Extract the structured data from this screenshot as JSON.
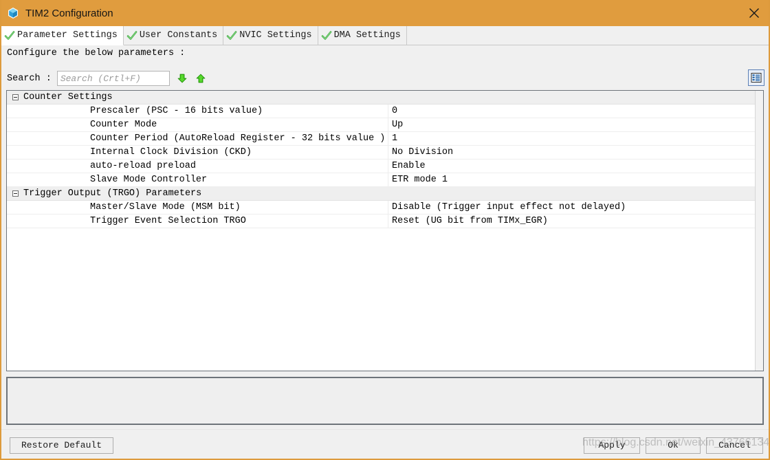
{
  "window": {
    "title": "TIM2 Configuration",
    "icon": "cube-icon",
    "close_label": "close-icon",
    "accent_color": "#e09c3e"
  },
  "tabs": [
    {
      "label": "Parameter Settings",
      "active": true,
      "icon": "green-check-icon"
    },
    {
      "label": "User Constants",
      "active": false,
      "icon": "green-check-icon"
    },
    {
      "label": "NVIC Settings",
      "active": false,
      "icon": "green-check-icon"
    },
    {
      "label": "DMA Settings",
      "active": false,
      "icon": "green-check-icon"
    }
  ],
  "content": {
    "configure_text": "Configure the below parameters :"
  },
  "search": {
    "label": "Search :",
    "value": "",
    "placeholder": "Search (Crtl+F)",
    "next_icon": "arrow-down-icon",
    "prev_icon": "arrow-up-icon",
    "list_view_icon": "list-view-icon"
  },
  "parameters": [
    {
      "type": "group",
      "name": "Counter Settings",
      "expanded": true,
      "rows": [
        {
          "name": "Prescaler (PSC - 16 bits value)",
          "value": "0"
        },
        {
          "name": "Counter Mode",
          "value": "Up"
        },
        {
          "name": "Counter Period (AutoReload Register - 32 bits value )",
          "value": "1"
        },
        {
          "name": "Internal Clock Division (CKD)",
          "value": "No Division"
        },
        {
          "name": "auto-reload preload",
          "value": "Enable"
        },
        {
          "name": "Slave Mode Controller",
          "value": "ETR mode 1"
        }
      ]
    },
    {
      "type": "group",
      "name": "Trigger Output (TRGO) Parameters",
      "expanded": true,
      "rows": [
        {
          "name": "Master/Slave Mode (MSM bit)",
          "value": "Disable (Trigger input effect not delayed)"
        },
        {
          "name": "Trigger Event Selection TRGO",
          "value": "Reset (UG bit from TIMx_EGR)"
        }
      ]
    }
  ],
  "footer": {
    "restore_default": "Restore Default",
    "apply": "Apply",
    "ok": "Ok",
    "cancel": "Cancel"
  },
  "watermark": {
    "text": "https://blog.csdn.net/weixin_43766134"
  }
}
